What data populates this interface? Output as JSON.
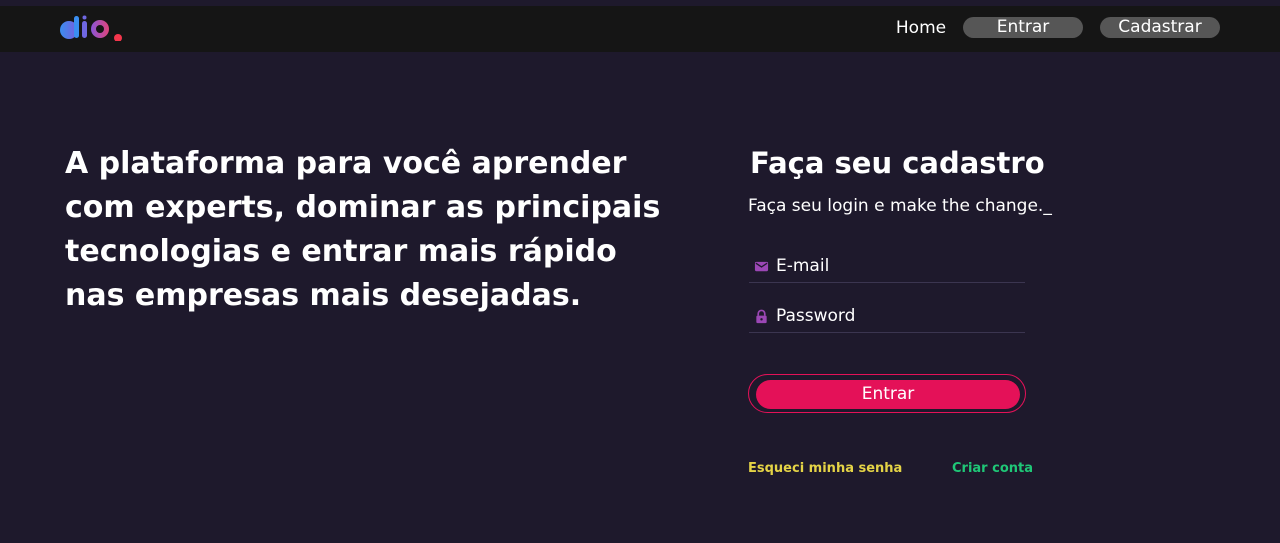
{
  "colors": {
    "background": "#1e192c",
    "header_bg": "#151515",
    "pill_bg": "#565656",
    "accent_pink": "#e41158",
    "icon_purple": "#9b47b5",
    "link_yellow": "#e4d346",
    "link_green": "#1fc777"
  },
  "header": {
    "logo_icon": "dio-logo",
    "nav": {
      "home_label": "Home",
      "entrar_label": "Entrar",
      "cadastrar_label": "Cadastrar"
    }
  },
  "hero": {
    "headline": "A plataforma para você aprender com experts, dominar as principais tecnologias e entrar mais rápido nas empresas mais desejadas."
  },
  "form": {
    "title": "Faça seu cadastro",
    "subtitle": "Faça seu login e make the change._",
    "email": {
      "icon": "mail-icon",
      "placeholder": "E-mail",
      "value": ""
    },
    "password": {
      "icon": "lock-icon",
      "placeholder": "Password",
      "value": ""
    },
    "submit_label": "Entrar",
    "forgot_label": "Esqueci minha senha",
    "create_label": "Criar conta"
  }
}
